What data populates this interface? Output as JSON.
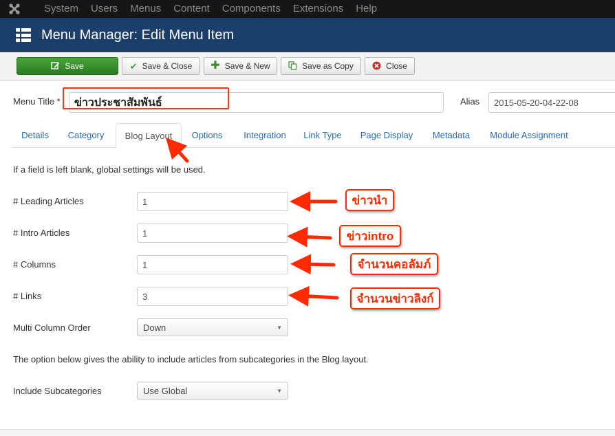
{
  "topbar": {
    "logo_icon": "joomla-logo-icon",
    "items": [
      "System",
      "Users",
      "Menus",
      "Content",
      "Components",
      "Extensions",
      "Help"
    ]
  },
  "header": {
    "icon": "list-menu-icon",
    "title": "Menu Manager: Edit Menu Item"
  },
  "toolbar": {
    "save": "Save",
    "save_close": "Save & Close",
    "save_new": "Save & New",
    "save_copy": "Save as Copy",
    "close": "Close"
  },
  "form": {
    "menu_title_label": "Menu Title *",
    "menu_title_value": "ข่าวประชาสัมพันธ์",
    "alias_label": "Alias",
    "alias_value": "2015-05-20-04-22-08"
  },
  "tabs": [
    "Details",
    "Category",
    "Blog Layout",
    "Options",
    "Integration",
    "Link Type",
    "Page Display",
    "Metadata",
    "Module Assignment"
  ],
  "active_tab": "Blog Layout",
  "blog_layout": {
    "intro_note": "If a field is left blank, global settings will be used.",
    "leading_articles_label": "# Leading Articles",
    "leading_articles_value": "1",
    "intro_articles_label": "# Intro Articles",
    "intro_articles_value": "1",
    "columns_label": "# Columns",
    "columns_value": "1",
    "links_label": "# Links",
    "links_value": "3",
    "multi_column_order_label": "Multi Column Order",
    "multi_column_order_value": "Down",
    "subcat_note": "The option below gives the ability to include articles from subcategories in the Blog layout.",
    "include_subcategories_label": "Include Subcategories",
    "include_subcategories_value": "Use Global"
  },
  "annotations": {
    "leading": "ข่าวนำ",
    "intro": "ข่าวintro",
    "columns": "จำนวนคอลัมภ์",
    "links": "จำนวนข่าวลิงก์"
  },
  "colors": {
    "topbar": "#161616",
    "header": "#1b3f6a",
    "save_green": "#2f8a26",
    "link_blue": "#2b6aa9",
    "annotation_red": "#ff2a00"
  }
}
